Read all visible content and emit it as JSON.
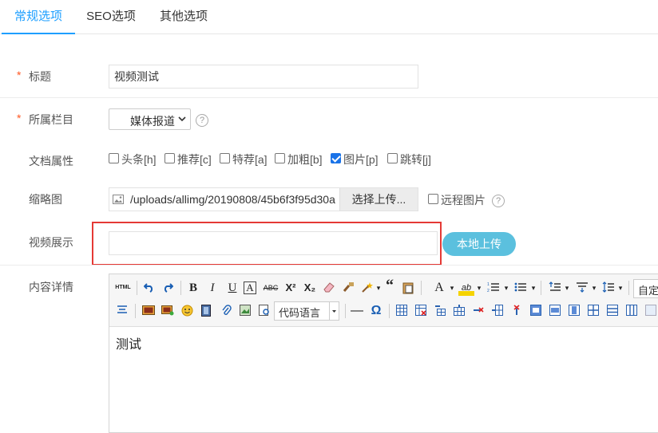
{
  "tabs": [
    {
      "label": "常规选项",
      "active": true
    },
    {
      "label": "SEO选项",
      "active": false
    },
    {
      "label": "其他选项",
      "active": false
    }
  ],
  "form": {
    "title": {
      "required_mark": "*",
      "label": "标题",
      "value": "视频测试"
    },
    "category": {
      "required_mark": "*",
      "label": "所属栏目",
      "selected": "媒体报道",
      "help": "?"
    },
    "attributes": {
      "label": "文档属性",
      "options": [
        {
          "label": "头条[h]",
          "checked": false
        },
        {
          "label": "推荐[c]",
          "checked": false
        },
        {
          "label": "特荐[a]",
          "checked": false
        },
        {
          "label": "加粗[b]",
          "checked": false
        },
        {
          "label": "图片[p]",
          "checked": true
        },
        {
          "label": "跳转[j]",
          "checked": false
        }
      ]
    },
    "thumbnail": {
      "label": "缩略图",
      "path": "/uploads/allimg/20190808/45b6f3f95d30a",
      "upload_button": "选择上传...",
      "remote_label": "远程图片",
      "remote_checked": false,
      "help": "?"
    },
    "video": {
      "label": "视频展示",
      "value": "",
      "upload_button": "本地上传"
    },
    "content": {
      "label": "内容详情",
      "code_language": "代码语言",
      "font_family": "自定",
      "body_text": "测试"
    }
  },
  "colors": {
    "accent": "#1e9fff",
    "required": "#ff5722",
    "upload_pill": "#5bc0de",
    "highlight_box": "#e53935"
  }
}
